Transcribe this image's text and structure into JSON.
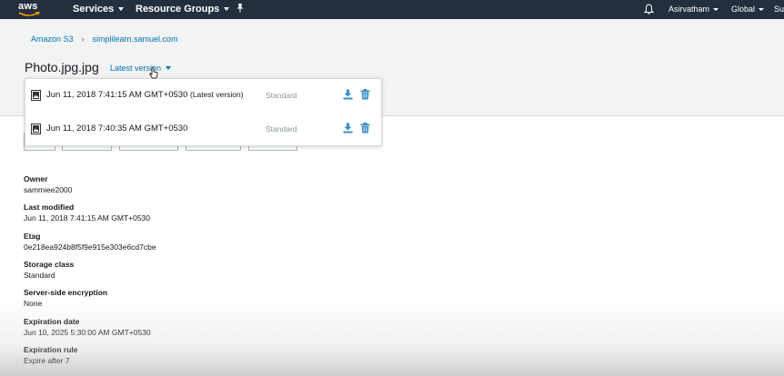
{
  "nav": {
    "logo_text": "aws",
    "services": "Services",
    "resource_groups": "Resource Groups",
    "user": "Asirvatham",
    "region": "Global",
    "support": "Su"
  },
  "breadcrumb": {
    "root": "Amazon S3",
    "bucket": "simplilearn.samuel.com"
  },
  "object": {
    "title": "Photo.jpg.jpg",
    "version_selector": "Latest version"
  },
  "versions": [
    {
      "date": "Jun 11, 2018 7:41:15 AM GMT+0530",
      "latest_tag": "(Latest version)",
      "storage_class": "Standard"
    },
    {
      "date": "Jun 11, 2018 7:40:35 AM GMT+0530",
      "latest_tag": "",
      "storage_class": "Standard"
    }
  ],
  "properties": [
    {
      "label": "Owner",
      "value": "sammiee2000"
    },
    {
      "label": "Last modified",
      "value": "Jun 11, 2018 7:41:15 AM GMT+0530"
    },
    {
      "label": "Etag",
      "value": "0e218ea924b8f5f9e915e303e6cd7cbe"
    },
    {
      "label": "Storage class",
      "value": "Standard"
    },
    {
      "label": "Server-side encryption",
      "value": "None"
    },
    {
      "label": "Expiration date",
      "value": "Jun 10, 2025 5:30:00 AM GMT+0530"
    },
    {
      "label": "Expiration rule",
      "value": "Expire after 7"
    }
  ],
  "colors": {
    "nav_bg": "#232f3e",
    "link": "#0073bb",
    "icon_blue": "#3b8fc4"
  }
}
